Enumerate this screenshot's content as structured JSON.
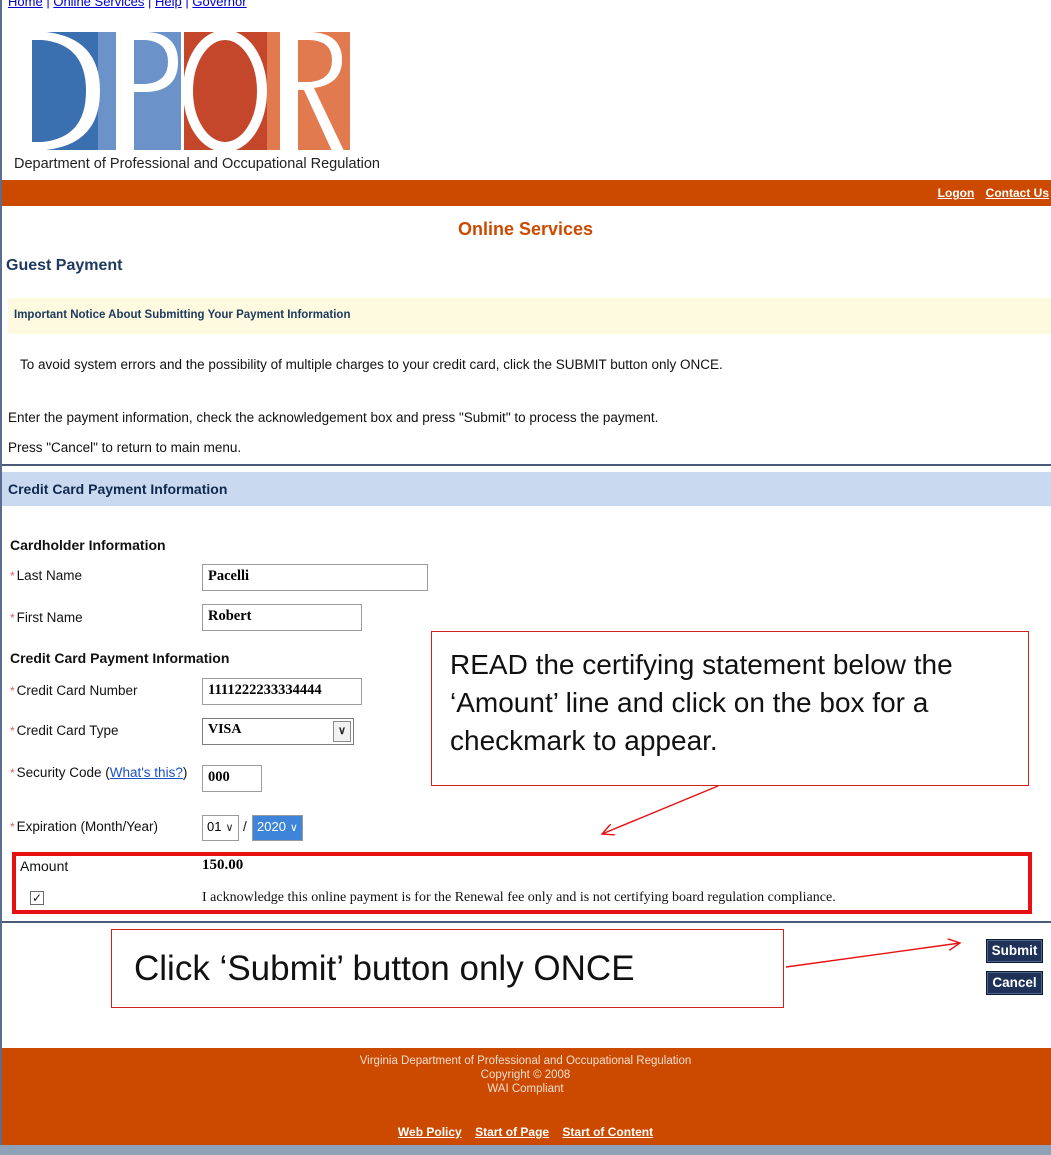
{
  "top_nav": {
    "items": [
      "Home",
      "Online Services",
      "Help",
      "Governor"
    ]
  },
  "logo": {
    "letters": "DPOR",
    "caption": "Department of Professional and Occupational Regulation"
  },
  "header_links": {
    "logon": "Logon",
    "contact": "Contact Us"
  },
  "page": {
    "title": "Online Services",
    "subtitle": "Guest Payment"
  },
  "notice": {
    "heading": "Important Notice About Submitting Your Payment Information",
    "warning": "To avoid system errors and the possibility of multiple charges to your credit card, click the SUBMIT button only ONCE.",
    "instruction": "Enter the payment information, check the acknowledgement box and press \"Submit\" to process the payment.",
    "cancel_note": "Press \"Cancel\" to return to main menu."
  },
  "form": {
    "section_title": "Credit Card Payment Information",
    "cardholder_heading": "Cardholder Information",
    "last_name_label": "Last Name",
    "last_name_value": "Pacelli",
    "first_name_label": "First Name",
    "first_name_value": "Robert",
    "payment_heading": "Credit Card Payment Information",
    "card_number_label": "Credit Card Number",
    "card_number_value": "1111222233334444",
    "card_type_label": "Credit Card Type",
    "card_type_value": "VISA",
    "security_code_label": "Security Code (",
    "security_code_link": "What's this?",
    "security_code_close": ")",
    "security_code_value": "000",
    "expiration_label": "Expiration (Month/Year)",
    "expiration_month": "01",
    "expiration_sep": "/",
    "expiration_year": "2020",
    "amount_label": "Amount",
    "amount_value": "150.00",
    "ack_checked": "✓",
    "ack_text": "I acknowledge this online payment is for the Renewal fee only and is not certifying board regulation compliance."
  },
  "buttons": {
    "submit": "Submit",
    "cancel": "Cancel"
  },
  "callouts": {
    "read_statement": "READ the certifying statement below the ‘Amount’ line and click on the box for a checkmark to appear.",
    "submit_once": "Click ‘Submit’ button only ONCE"
  },
  "footer": {
    "line1": "Virginia Department of Professional and Occupational Regulation",
    "line2": "Copyright © 2008",
    "line3": "WAI Compliant",
    "links": [
      "Web Policy",
      "Start of Page",
      "Start of Content"
    ]
  },
  "colors": {
    "brand_orange": "#cc4a00",
    "logo_blue": "#3a6fb0",
    "logo_red": "#c4472c",
    "logo_salmon": "#e27a4f",
    "button_navy": "#1e3158",
    "callout_red": "#e81010"
  }
}
